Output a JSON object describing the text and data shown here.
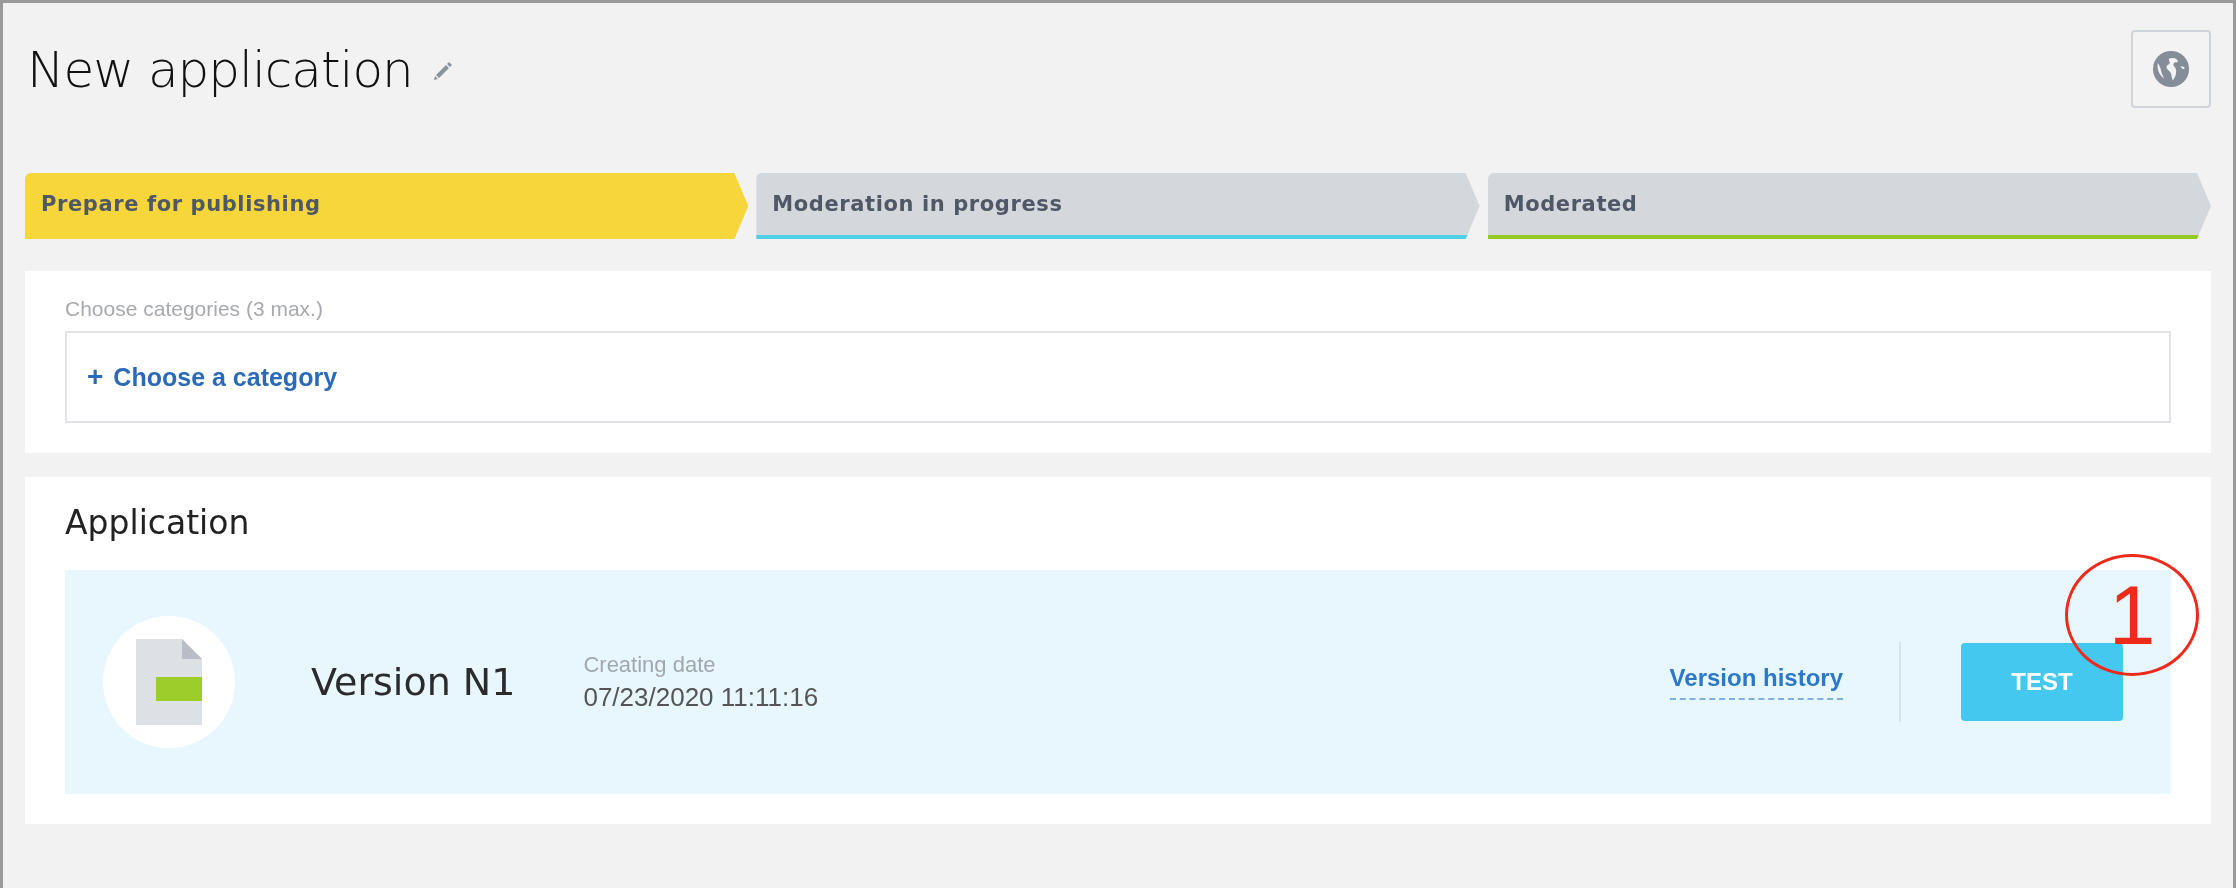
{
  "header": {
    "title": "New application"
  },
  "steps": [
    {
      "label": "Prepare for publishing",
      "selected": true,
      "color": "#f6d63b"
    },
    {
      "label": "Moderation in progress",
      "selected": false,
      "color": "#4fd0e6"
    },
    {
      "label": "Moderated",
      "selected": false,
      "color": "#94c923"
    }
  ],
  "categories": {
    "label": "Choose categories (3 max.)",
    "action_icon": "+",
    "action": "Choose a category"
  },
  "application": {
    "heading": "Application",
    "version": {
      "name": "Version N1",
      "date_label": "Creating date",
      "date": "07/23/2020 11:11:16",
      "history_link": "Version history",
      "test_button": "TEST"
    }
  },
  "annotation": {
    "label": "1"
  }
}
